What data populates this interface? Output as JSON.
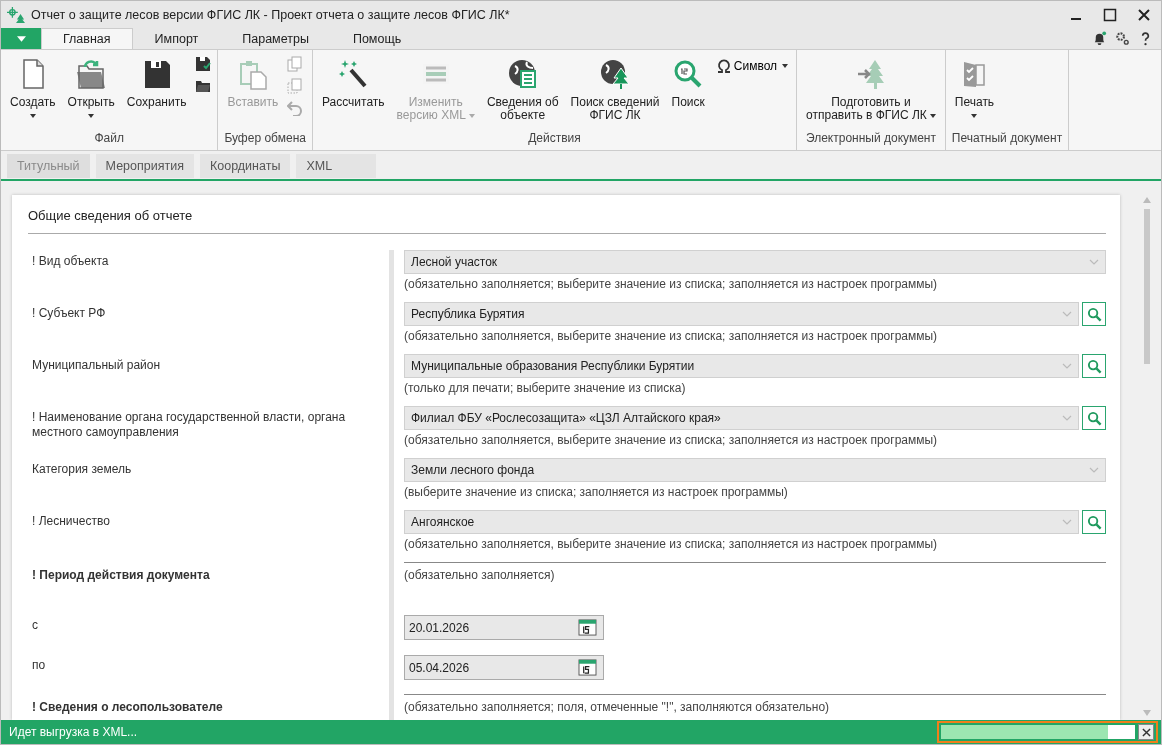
{
  "window": {
    "title": "Отчет о защите лесов версии ФГИС ЛК - Проект отчета о защите лесов ФГИС ЛК*"
  },
  "ribbon_tabs": [
    {
      "label": "Главная",
      "selected": true
    },
    {
      "label": "Импорт",
      "selected": false
    },
    {
      "label": "Параметры",
      "selected": false
    },
    {
      "label": "Помощь",
      "selected": false
    }
  ],
  "ribbon_groups": [
    {
      "title": "Файл",
      "buttons": [
        {
          "kind": "large",
          "label": "Создать",
          "dropdown": true,
          "disabled": false
        },
        {
          "kind": "large",
          "label": "Открыть",
          "dropdown": true,
          "disabled": false
        },
        {
          "kind": "large",
          "label": "Сохранить",
          "dropdown": false,
          "disabled": false
        }
      ]
    },
    {
      "title": "Буфер обмена",
      "buttons": [
        {
          "kind": "large",
          "label": "Вставить",
          "dropdown": false,
          "disabled": true
        }
      ]
    },
    {
      "title": "Действия",
      "buttons": [
        {
          "kind": "large",
          "label": "Рассчитать",
          "dropdown": false,
          "disabled": false
        },
        {
          "kind": "large",
          "label": "Изменить\nверсию XML",
          "dropdown": true,
          "disabled": true
        },
        {
          "kind": "large",
          "label": "Сведения об\nобъекте",
          "dropdown": false,
          "disabled": false
        },
        {
          "kind": "large",
          "label": "Поиск сведений\nФГИС ЛК",
          "dropdown": false,
          "disabled": false
        },
        {
          "kind": "large",
          "label": "Поиск",
          "dropdown": false,
          "disabled": false
        },
        {
          "kind": "inline",
          "label": "Символ",
          "dropdown": true,
          "disabled": false
        }
      ]
    },
    {
      "title": "Электронный документ",
      "buttons": [
        {
          "kind": "large",
          "label": "Подготовить и\nотправить в ФГИС ЛК",
          "dropdown": true,
          "disabled": false
        }
      ]
    },
    {
      "title": "Печатный документ",
      "buttons": [
        {
          "kind": "large",
          "label": "Печать",
          "dropdown": true,
          "disabled": false
        }
      ]
    }
  ],
  "doc_tabs": [
    {
      "label": "Титульный",
      "selected": true
    },
    {
      "label": "Мероприятия",
      "selected": false
    },
    {
      "label": "Координаты",
      "selected": false
    },
    {
      "label": "XML",
      "selected": false
    }
  ],
  "section_title": "Общие сведения об отчете",
  "rows": [
    {
      "kind": "select",
      "label": "! Вид объекта",
      "value": "Лесной участок",
      "hint": "(обязательно заполняется; выберите значение из списка; заполняется из настроек программы)",
      "search": false
    },
    {
      "kind": "select",
      "label": "! Субъект РФ",
      "value": "Республика Бурятия",
      "hint": "(обязательно заполняется, выберите значение из списка; заполняется из настроек программы)",
      "search": true
    },
    {
      "kind": "select",
      "label": "Муниципальный район",
      "value": "Муниципальные образования Республики Бурятии",
      "hint": "(только для печати; выберите значение из списка)",
      "search": true
    },
    {
      "kind": "select",
      "label": "! Наименование органа государственной власти, органа местного самоуправления",
      "value": "Филиал ФБУ «Рослесозащита» «ЦЗЛ Алтайского края»",
      "hint": "(обязательно заполняется, выберите значение из списка; заполняется из настроек программы)",
      "search": true
    },
    {
      "kind": "select",
      "label": "Категория земель",
      "value": "Земли лесного фонда",
      "hint": "(выберите значение из списка; заполняется из настроек программы)",
      "search": false
    },
    {
      "kind": "select",
      "label": "! Лесничество",
      "value": "Ангоянское",
      "hint": "(обязательно заполняется, выберите значение из списка; заполняется из настроек программы)",
      "search": true
    },
    {
      "kind": "section",
      "label": "! Период действия документа",
      "hint": "(обязательно заполняется)"
    },
    {
      "kind": "date",
      "label": "с",
      "value": "20.01.2026"
    },
    {
      "kind": "date",
      "label": "по",
      "value": "05.04.2026"
    },
    {
      "kind": "section",
      "label": "! Сведения о лесопользователе",
      "hint": "(обязательно заполняется; поля, отмеченные \"!\", заполняются обязательно)"
    }
  ],
  "status_bar": {
    "text": "Идет выгрузка в XML...",
    "progress": {
      "level": 0.86
    }
  }
}
